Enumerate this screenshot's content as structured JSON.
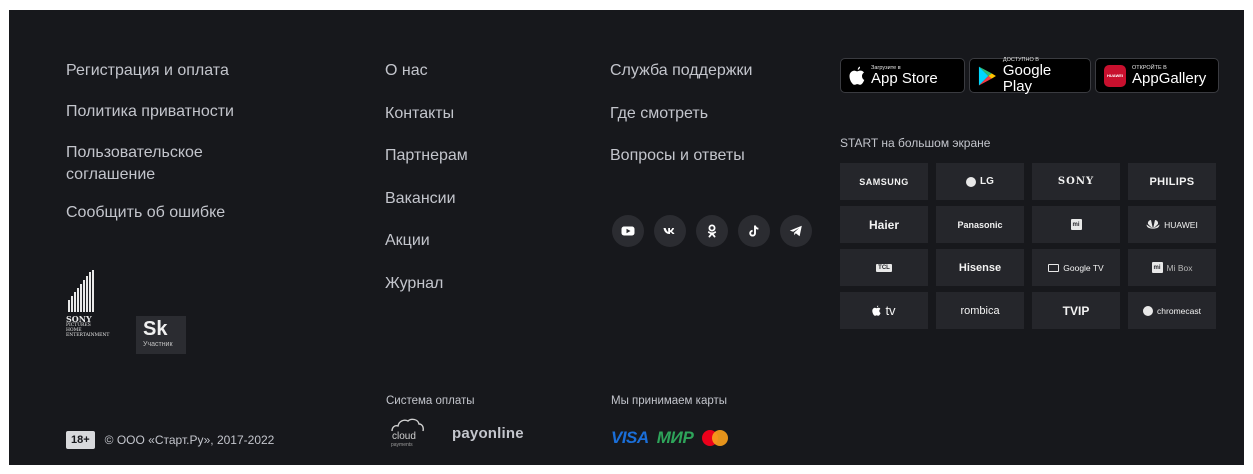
{
  "col1": {
    "links": [
      "Регистрация и оплата",
      "Политика приватности",
      "Пользовательское соглашение",
      "Сообщить об ошибке"
    ]
  },
  "col2": {
    "links": [
      "О нас",
      "Контакты",
      "Партнерам",
      "Вакансии",
      "Акции",
      "Журнал"
    ]
  },
  "col3": {
    "links": [
      "Служба поддержки",
      "Где смотреть",
      "Вопросы и ответы"
    ]
  },
  "socials": [
    "youtube-icon",
    "vk-icon",
    "odnoklassniki-icon",
    "tiktok-icon",
    "telegram-icon"
  ],
  "partners": {
    "sony_line1": "SONY",
    "sony_line2": "PICTURES",
    "sony_line3": "HOME",
    "sony_line4": "ENTERTAINMENT",
    "sk_big": "Sk",
    "sk_small": "Участник"
  },
  "legal": {
    "age": "18+",
    "copyright": "© ООО «Старт.Ру», 2017-2022"
  },
  "payment_system": {
    "title": "Система оплаты",
    "cloud_word": "cloud",
    "cloud_sub": "payments",
    "payonline": "payonline"
  },
  "cards": {
    "title": "Мы принимаем карты",
    "visa": "VISA",
    "mir": "МИР"
  },
  "stores": {
    "appstore_small": "Загрузите в",
    "appstore_big": "App Store",
    "googleplay_small": "ДОСТУПНО В",
    "googleplay_big": "Google Play",
    "appgallery_small": "ОТКРОЙТЕ В",
    "appgallery_big": "AppGallery",
    "appgallery_icon_text": "HUAWEI"
  },
  "screens": {
    "title": "START на большом экране",
    "brands": [
      "SAMSUNG",
      "LG",
      "SONY",
      "PHILIPS",
      "Haier",
      "Panasonic",
      "mi",
      "HUAWEI",
      "TCL",
      "Hisense",
      "Google TV",
      "Mi Box",
      "tv",
      "rombica",
      "TVIP",
      "chromecast"
    ]
  },
  "colors": {
    "background": "#17181c",
    "tile": "#25262b",
    "text": "#c3c5cc"
  }
}
